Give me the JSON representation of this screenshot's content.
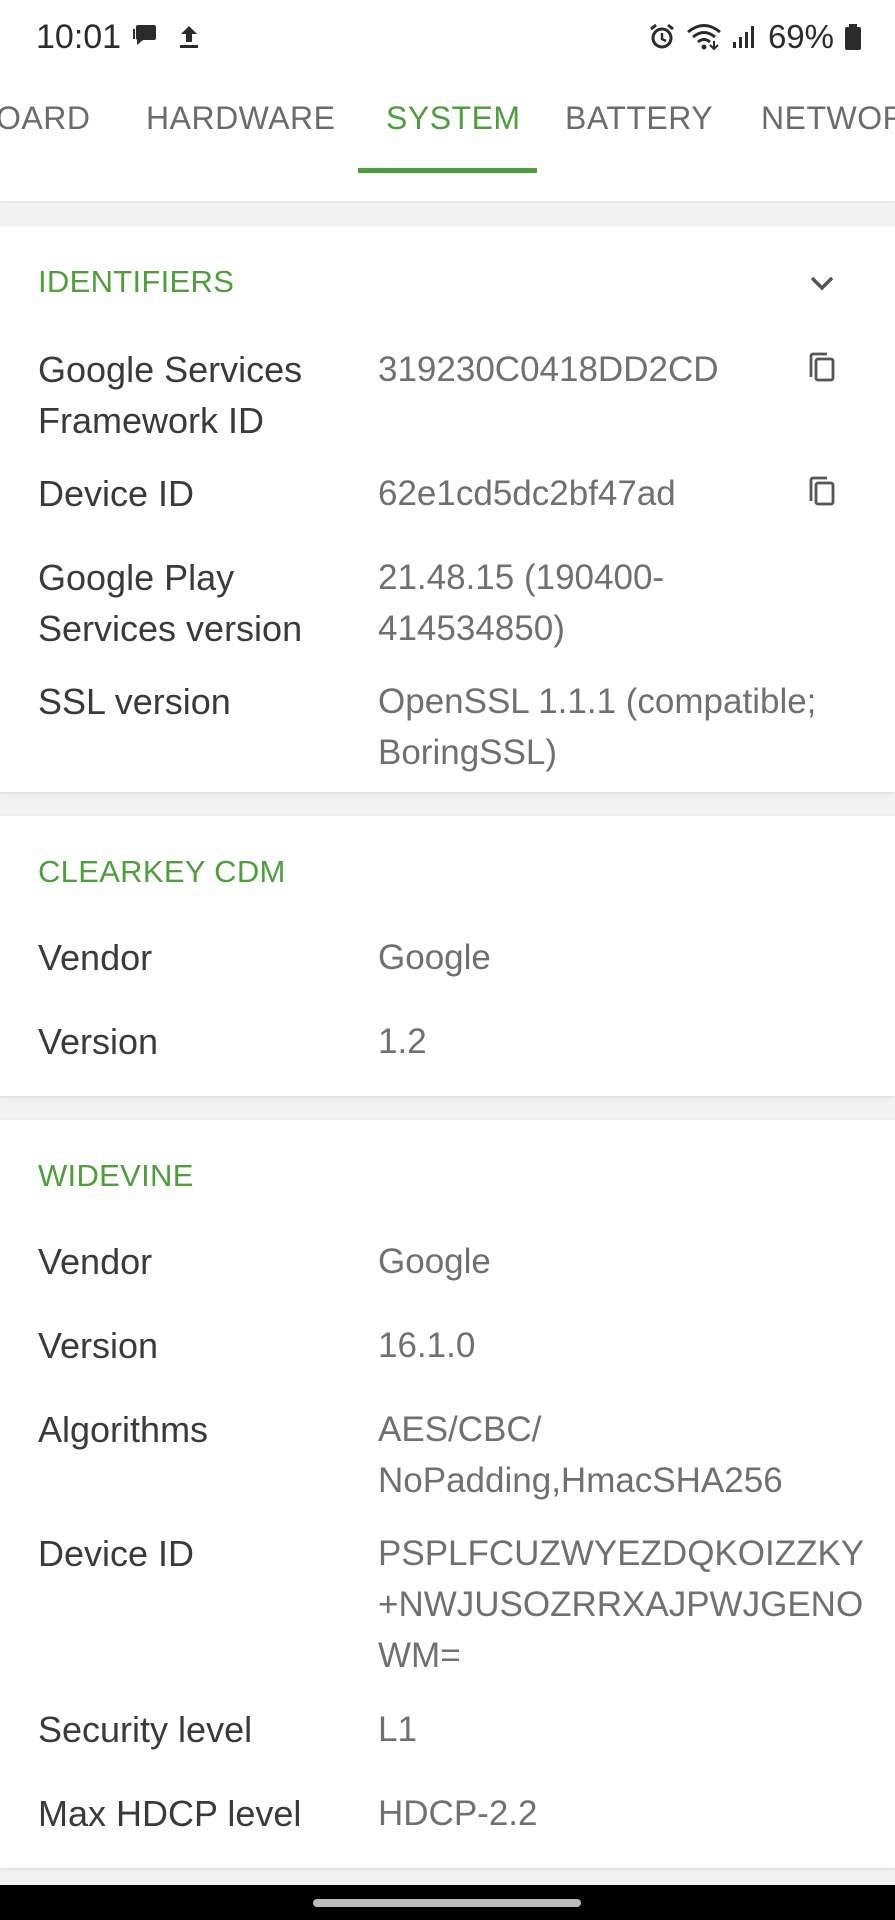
{
  "status_bar": {
    "time": "10:01",
    "left_icons": [
      "chat-icon",
      "upload-icon"
    ],
    "right_icons": [
      "alarm-icon",
      "wifi-icon",
      "signal-icon",
      "battery-icon"
    ],
    "battery": "69%"
  },
  "tabs": [
    {
      "label": "OARD",
      "active": false
    },
    {
      "label": "HARDWARE",
      "active": false
    },
    {
      "label": "SYSTEM",
      "active": true
    },
    {
      "label": "BATTERY",
      "active": false
    },
    {
      "label": "NETWOR",
      "active": false
    }
  ],
  "colors": {
    "accent": "#4e9e3c",
    "label": "#3a3a3a",
    "value": "#707070",
    "background": "#f2f2f2"
  },
  "identifiers": {
    "title": "IDENTIFIERS",
    "rows": [
      {
        "label": "Google Services Framework ID",
        "value": "319230C0418DD2CD"
      },
      {
        "label": "Device ID",
        "value": "62e1cd5dc2bf47ad"
      },
      {
        "label": "Google Play Services version",
        "value": "21.48.15 (190400-414534850)"
      },
      {
        "label": "SSL version",
        "value": "OpenSSL 1.1.1 (compatible; BoringSSL)"
      }
    ]
  },
  "clearkey": {
    "title": "CLEARKEY CDM",
    "rows": [
      {
        "label": "Vendor",
        "value": "Google"
      },
      {
        "label": "Version",
        "value": "1.2"
      }
    ]
  },
  "widevine": {
    "title": "WIDEVINE",
    "rows": [
      {
        "label": "Vendor",
        "value": "Google"
      },
      {
        "label": "Version",
        "value": "16.1.0"
      },
      {
        "label": "Algorithms",
        "value": "AES/CBC/ NoPadding,HmacSHA256"
      },
      {
        "label": "Device ID",
        "value": "PSPLFCUZWYEZDQKOIZZKY+NWJUSOZRRXAJPWJGENOWM="
      },
      {
        "label": "Security level",
        "value": "L1"
      },
      {
        "label": "Max HDCP level",
        "value": "HDCP-2.2"
      }
    ]
  }
}
